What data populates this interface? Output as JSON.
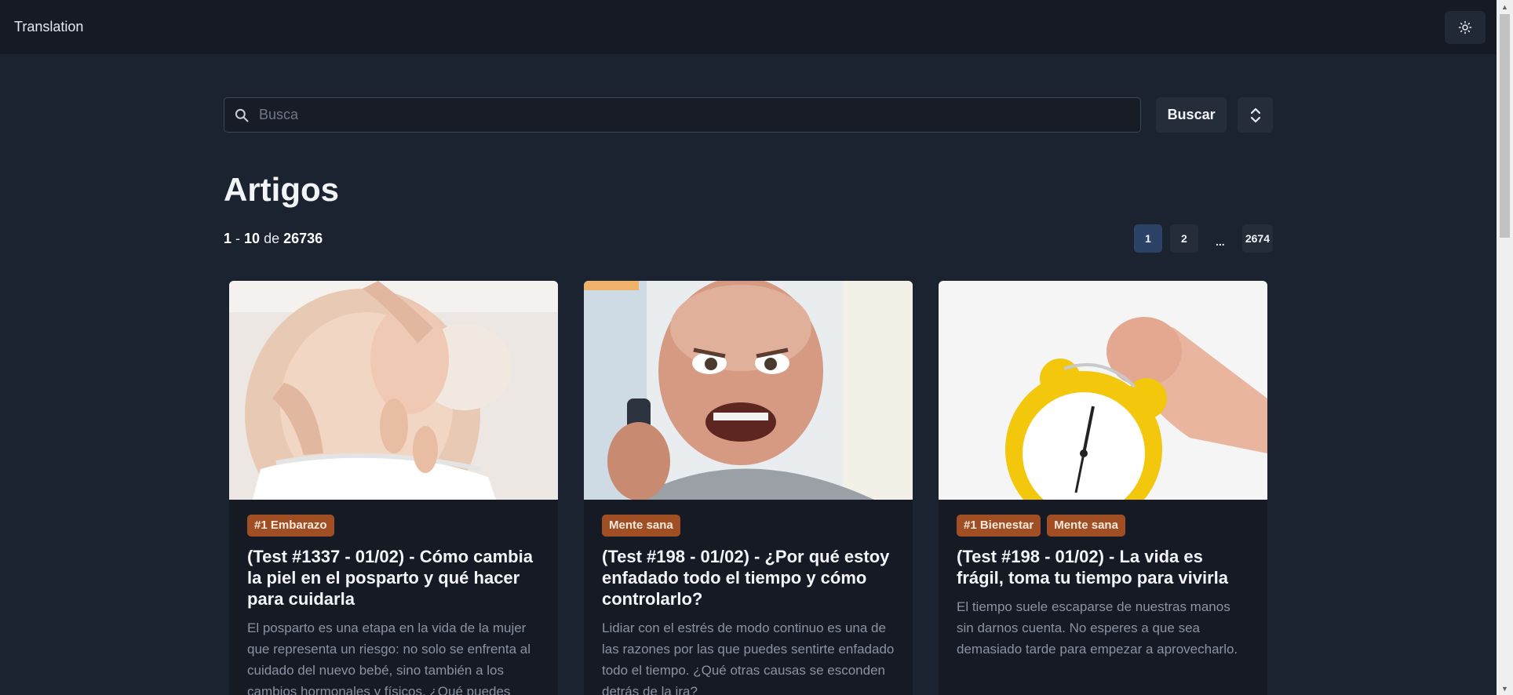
{
  "topbar": {
    "title": "Translation",
    "theme_icon": "sun-icon"
  },
  "search": {
    "placeholder": "Busca",
    "value": "",
    "button_label": "Buscar",
    "sort_icon": "sort-toggle-icon"
  },
  "page": {
    "heading": "Artigos"
  },
  "results": {
    "from": "1",
    "sep": "-",
    "to": "10",
    "of_label": "de",
    "total": "26736"
  },
  "pagination": {
    "pages": [
      "1",
      "2",
      "...",
      "2674"
    ],
    "active": "1"
  },
  "colors": {
    "background": "#1b2230",
    "topbar": "#151a24",
    "card": "#151a24",
    "tag": "#a04f24",
    "active_page": "#2c4266"
  },
  "cards": [
    {
      "image": "pregnant-belly-with-baby-photo",
      "tags": [
        "#1 Embarazo"
      ],
      "title": "(Test #1337 - 01/02) - Cómo cambia la piel en el posparto y qué hacer para cuidarla",
      "description": "El posparto es una etapa en la vida de la mujer que representa un riesgo: no solo se enfrenta al cuidado del nuevo bebé, sino también a los cambios hormonales y físicos. ¿Qué puedes"
    },
    {
      "image": "angry-man-on-phone-photo",
      "tags": [
        "Mente sana"
      ],
      "title": "(Test #198 - 01/02) - ¿Por qué estoy enfadado todo el tiempo y cómo controlarlo?",
      "description": "Lidiar con el estrés de modo continuo es una de las razones por las que puedes sentirte enfadado todo el tiempo. ¿Qué otras causas se esconden detrás de la ira?"
    },
    {
      "image": "yellow-alarm-clock-fist-photo",
      "tags": [
        "#1 Bienestar",
        "Mente sana"
      ],
      "title": "(Test #198 - 01/02) - La vida es frágil, toma tu tiempo para vivirla",
      "description": "El tiempo suele escaparse de nuestras manos sin darnos cuenta. No esperes a que sea demasiado tarde para empezar a aprovecharlo."
    }
  ]
}
